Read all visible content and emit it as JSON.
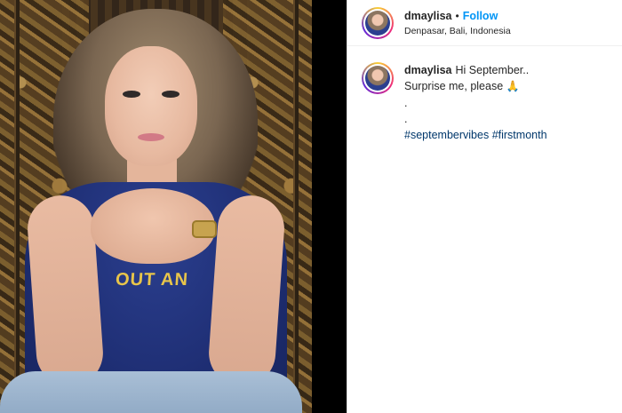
{
  "post": {
    "username": "dmaylisa",
    "separator": "•",
    "follow_label": "Follow",
    "location": "Denpasar, Bali, Indonesia"
  },
  "photo": {
    "shirt_text": "OUT AN"
  },
  "caption": {
    "username": "dmaylisa",
    "line1": "Hi September..",
    "line2": "Surprise me, please",
    "emoji": "🙏",
    "line3": ".",
    "line4": ".",
    "hashtags": [
      "#septembervibes",
      "#firstmonth"
    ]
  },
  "colors": {
    "follow": "#0095f6",
    "hashtag": "#00376b",
    "text": "#262626"
  },
  "icons": [
    "avatar-story-ring",
    "praying-hands-emoji"
  ]
}
